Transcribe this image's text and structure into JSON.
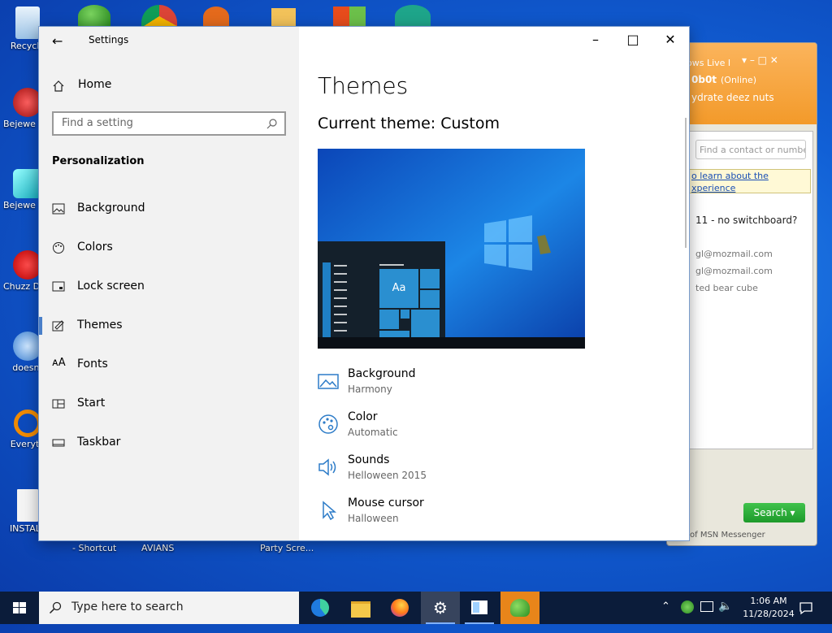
{
  "desktop": {
    "icons": [
      {
        "label": "Recycle"
      },
      {
        "label": "Bejewe Delux"
      },
      {
        "label": "Bejewe Delux"
      },
      {
        "label": "Chuzz Delux"
      },
      {
        "label": "doesnt"
      },
      {
        "label": "Everyth"
      },
      {
        "label": "INSTALL"
      }
    ],
    "bottom_labels": [
      "- Shortcut",
      "AVIANS",
      "Party Scre..."
    ]
  },
  "msn": {
    "title": "ows Live I",
    "user": "0b0t",
    "status": "(Online)",
    "personal_message": "ydrate deez nuts",
    "find_placeholder": "Find a contact or numbe",
    "banner_line1": "o learn about the",
    "banner_line2": "xperience",
    "lines": [
      "11 - no switchboard?",
      "gl@mozmail.com",
      "gl@mozmail.com",
      "ted bear cube"
    ],
    "search_label": "Search",
    "ad_text": "of MSN Messenger"
  },
  "settings": {
    "window_title": "Settings",
    "home_label": "Home",
    "find_placeholder": "Find a setting",
    "section_heading": "Personalization",
    "nav": [
      {
        "label": "Background",
        "icon": "picture-icon"
      },
      {
        "label": "Colors",
        "icon": "palette-icon"
      },
      {
        "label": "Lock screen",
        "icon": "lock-screen-icon"
      },
      {
        "label": "Themes",
        "icon": "themes-icon",
        "selected": true
      },
      {
        "label": "Fonts",
        "icon": "fonts-icon"
      },
      {
        "label": "Start",
        "icon": "start-icon"
      },
      {
        "label": "Taskbar",
        "icon": "taskbar-icon"
      }
    ],
    "page_title": "Themes",
    "current_theme": "Current theme: Custom",
    "preview_tile_text": "Aa",
    "properties": [
      {
        "name": "Background",
        "value": "Harmony",
        "icon": "picture-icon"
      },
      {
        "name": "Color",
        "value": "Automatic",
        "icon": "palette-icon"
      },
      {
        "name": "Sounds",
        "value": "Helloween 2015",
        "icon": "speaker-icon"
      },
      {
        "name": "Mouse cursor",
        "value": "Halloween",
        "icon": "cursor-icon"
      }
    ],
    "accent_color": "#4a7fc9"
  },
  "taskbar": {
    "search_placeholder": "Type here to search",
    "time": "1:06 AM",
    "date": "11/28/2024"
  }
}
